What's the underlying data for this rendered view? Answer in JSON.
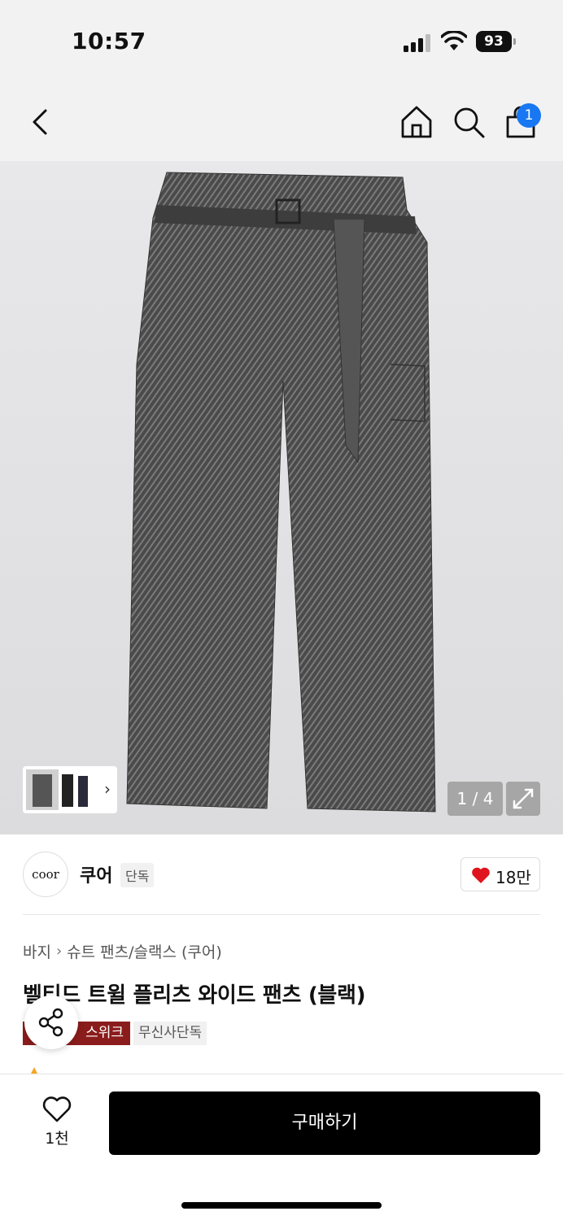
{
  "status_bar": {
    "time": "10:57",
    "battery": "93"
  },
  "nav": {
    "cart_badge": "1",
    "icons": [
      "back-icon",
      "home-icon",
      "search-icon",
      "cart-icon"
    ]
  },
  "gallery": {
    "counter": "1 / 4",
    "thumb_chevron": "›"
  },
  "brand": {
    "logo_text": "coor",
    "name": "쿠어",
    "tag": "단독",
    "like_count": "18만"
  },
  "product": {
    "breadcrumb": [
      "바지",
      "슈트 팬츠/슬랙스 (쿠어)"
    ],
    "breadcrumb_separator": "›",
    "title": "벨티드 트윌 플리츠 와이드 팬츠 (블랙)",
    "tags": [
      "스위크",
      "무신사단독"
    ]
  },
  "bottom_bar": {
    "wish_count": "1천",
    "buy_label": "구매하기"
  },
  "colors": {
    "accent_blue": "#1877f2",
    "heart_red": "#e0141e",
    "tag_red": "#8b1c1c",
    "buy_black": "#000000"
  }
}
